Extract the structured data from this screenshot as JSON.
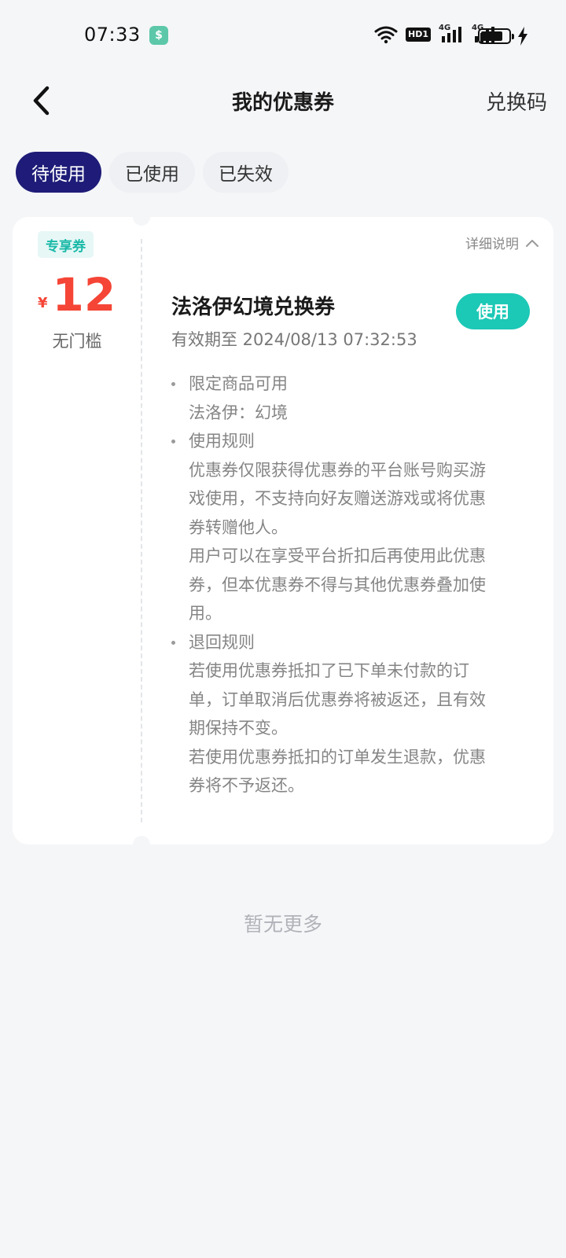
{
  "status_bar": {
    "time": "07:33",
    "app_icon_char": "$",
    "hd_label": "HD1",
    "net_1": "4G",
    "net_2": "4G",
    "battery_level_percent": 80,
    "icons": [
      "wifi-icon",
      "hd-voice-icon",
      "signal-4g-icon",
      "signal-4g-icon",
      "battery-icon",
      "charging-bolt-icon"
    ]
  },
  "header": {
    "title": "我的优惠券",
    "redeem_label": "兑换码"
  },
  "tabs": [
    {
      "label": "待使用",
      "active": true
    },
    {
      "label": "已使用",
      "active": false
    },
    {
      "label": "已失效",
      "active": false
    }
  ],
  "coupon": {
    "badge": "专享券",
    "currency": "¥",
    "amount": "12",
    "threshold": "无门槛",
    "detail_toggle": "详细说明",
    "title": "法洛伊幻境兑换券",
    "validity": "有效期至 2024/08/13 07:32:53",
    "use_label": "使用",
    "rules": [
      {
        "heading": "限定商品可用",
        "lines": [
          "法洛伊：幻境"
        ]
      },
      {
        "heading": "使用规则",
        "lines": [
          "优惠券仅限获得优惠券的平台账号购买游",
          "戏使用，不支持向好友赠送游戏或将优惠",
          "券转赠他人。",
          "用户可以在享受平台折扣后再使用此优惠",
          "券，但本优惠券不得与其他优惠券叠加使",
          "用。"
        ]
      },
      {
        "heading": "退回规则",
        "lines": [
          "若使用优惠券抵扣了已下单未付款的订",
          "单，订单取消后优惠券将被返还，且有效",
          "期保持不变。",
          "若使用优惠券抵扣的订单发生退款，优惠",
          "券将不予返还。"
        ]
      }
    ]
  },
  "footer": {
    "no_more": "暂无更多"
  },
  "colors": {
    "tab_active_bg": "#1e1c78",
    "accent_teal": "#1cc8b6",
    "price_red": "#f54536",
    "page_bg": "#f5f6f8"
  }
}
